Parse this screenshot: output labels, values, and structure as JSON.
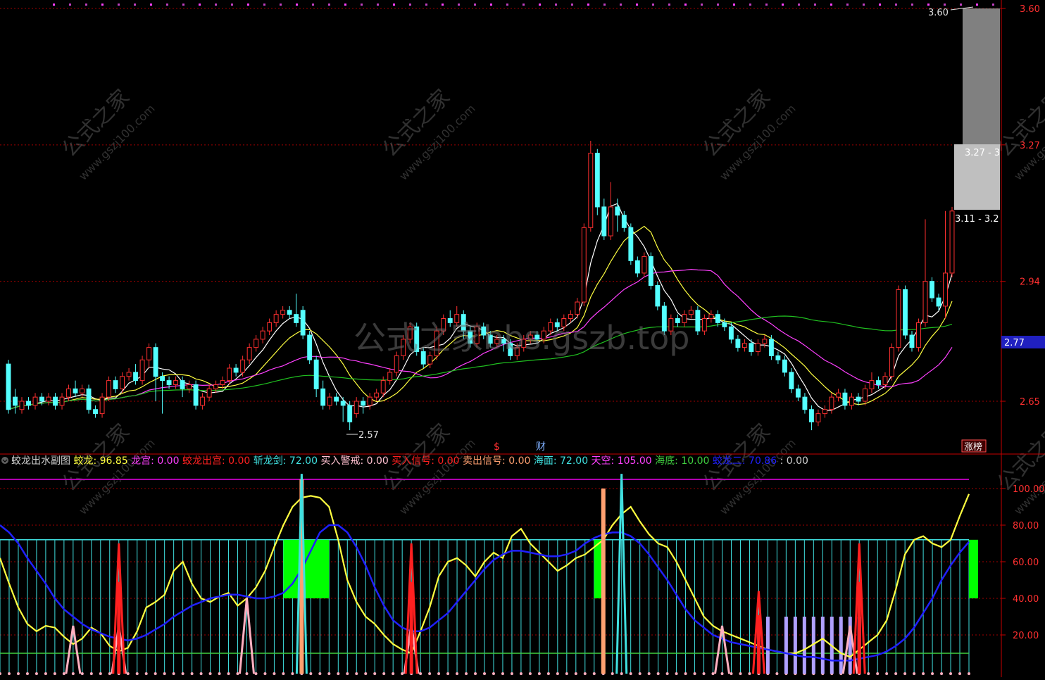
{
  "colors": {
    "background": "#000000",
    "up_candle": "#ff3030",
    "down_candle": "#54ffff",
    "axis_red": "#c80000",
    "ma5": "#ffffff",
    "ma10": "#ffff40",
    "ma20": "#ff40ff",
    "ma60": "#20c020",
    "jiaolong": "#ffff40",
    "long_curve": "#2020ff",
    "haimian": "#40e0e0",
    "tiankong": "#b000b0",
    "haidi": "#40d040",
    "sell_signal": "#ffa070",
    "buy_signal": "#ff2020",
    "alert": "#ffb0c0",
    "lavender": "#b0a0ff",
    "green_block": "#00ff00",
    "price_tag_bg": "#2020c0"
  },
  "main_chart": {
    "y_axis_labels": [
      "3.60",
      "3.27",
      "2.94",
      "2.65"
    ],
    "current_price_tag": "2.77",
    "high_marker": "3.60",
    "low_marker": "2.57",
    "range_box_upper": "3.27 - 3",
    "range_box_lower": "3.11 - 3.2",
    "event_s": "$",
    "event_cai": "财",
    "zhangbang": "涨榜"
  },
  "indicator_panel": {
    "title": "蛟龙出水副图",
    "legend": [
      {
        "label": "蛟龙:",
        "value": "96.85",
        "color": "#ffff40"
      },
      {
        "label": "龙宫:",
        "value": "0.00",
        "color": "#ff40ff"
      },
      {
        "label": "蛟龙出宫:",
        "value": "0.00",
        "color": "#ff2020"
      },
      {
        "label": "斩龙剑:",
        "value": "72.00",
        "color": "#40e0e0"
      },
      {
        "label": "买入警戒:",
        "value": "0.00",
        "color": "#ffc0d0"
      },
      {
        "label": "买入信号:",
        "value": "0.00",
        "color": "#ff2020"
      },
      {
        "label": "卖出信号:",
        "value": "0.00",
        "color": "#ffa070"
      },
      {
        "label": "海面:",
        "value": "72.00",
        "color": "#40e0e0"
      },
      {
        "label": "天空:",
        "value": "105.00",
        "color": "#ff40ff"
      },
      {
        "label": "海底:",
        "value": "10.00",
        "color": "#40d040"
      },
      {
        "label": "蛟龙二:",
        "value": "70.86",
        "color": "#2020ff"
      },
      {
        "label": ":",
        "value": "0.00",
        "color": "#d0d0d0"
      }
    ],
    "y_axis_labels": [
      "100.00",
      "80.00",
      "60.00",
      "40.00",
      "20.00"
    ]
  },
  "watermarks": {
    "main": "公式之家bbs.gszb.top",
    "tile_cn": "公式之家",
    "tile_url": "www.gszj100.com"
  },
  "chart_data": [
    {
      "type": "candlestick",
      "title": "",
      "ylim": [
        2.55,
        3.62
      ],
      "y_ticks": [
        3.6,
        3.27,
        2.94,
        2.65
      ],
      "candles": [
        [
          2.74,
          2.63,
          2.75,
          2.62
        ],
        [
          2.66,
          2.64,
          2.68,
          2.62
        ],
        [
          2.63,
          2.65,
          2.66,
          2.62
        ],
        [
          2.65,
          2.64,
          2.66,
          2.63
        ],
        [
          2.64,
          2.66,
          2.67,
          2.63
        ],
        [
          2.66,
          2.65,
          2.67,
          2.64
        ],
        [
          2.65,
          2.66,
          2.67,
          2.64
        ],
        [
          2.66,
          2.64,
          2.67,
          2.63
        ],
        [
          2.64,
          2.66,
          2.67,
          2.63
        ],
        [
          2.66,
          2.68,
          2.69,
          2.65
        ],
        [
          2.68,
          2.67,
          2.7,
          2.66
        ],
        [
          2.67,
          2.68,
          2.69,
          2.66
        ],
        [
          2.68,
          2.63,
          2.69,
          2.62
        ],
        [
          2.63,
          2.62,
          2.64,
          2.61
        ],
        [
          2.62,
          2.66,
          2.67,
          2.61
        ],
        [
          2.66,
          2.7,
          2.71,
          2.65
        ],
        [
          2.7,
          2.68,
          2.71,
          2.67
        ],
        [
          2.68,
          2.71,
          2.72,
          2.67
        ],
        [
          2.71,
          2.72,
          2.73,
          2.7
        ],
        [
          2.72,
          2.7,
          2.74,
          2.69
        ],
        [
          2.7,
          2.75,
          2.76,
          2.69
        ],
        [
          2.75,
          2.78,
          2.79,
          2.73
        ],
        [
          2.78,
          2.71,
          2.79,
          2.65
        ],
        [
          2.71,
          2.7,
          2.72,
          2.62
        ],
        [
          2.7,
          2.69,
          2.71,
          2.68
        ],
        [
          2.69,
          2.7,
          2.71,
          2.68
        ],
        [
          2.7,
          2.68,
          2.71,
          2.66
        ],
        [
          2.68,
          2.69,
          2.7,
          2.67
        ],
        [
          2.69,
          2.64,
          2.7,
          2.63
        ],
        [
          2.64,
          2.66,
          2.67,
          2.63
        ],
        [
          2.66,
          2.68,
          2.69,
          2.65
        ],
        [
          2.68,
          2.69,
          2.7,
          2.67
        ],
        [
          2.69,
          2.7,
          2.71,
          2.68
        ],
        [
          2.7,
          2.73,
          2.74,
          2.69
        ],
        [
          2.73,
          2.72,
          2.74,
          2.71
        ],
        [
          2.72,
          2.75,
          2.76,
          2.71
        ],
        [
          2.75,
          2.78,
          2.79,
          2.74
        ],
        [
          2.78,
          2.8,
          2.81,
          2.77
        ],
        [
          2.8,
          2.82,
          2.83,
          2.79
        ],
        [
          2.82,
          2.84,
          2.85,
          2.81
        ],
        [
          2.84,
          2.86,
          2.87,
          2.83
        ],
        [
          2.86,
          2.87,
          2.88,
          2.85
        ],
        [
          2.87,
          2.86,
          2.88,
          2.85
        ],
        [
          2.86,
          2.84,
          2.91,
          2.83
        ],
        [
          2.87,
          2.81,
          2.88,
          2.8
        ],
        [
          2.81,
          2.75,
          2.82,
          2.74
        ],
        [
          2.75,
          2.68,
          2.76,
          2.66
        ],
        [
          2.68,
          2.64,
          2.7,
          2.63
        ],
        [
          2.64,
          2.66,
          2.67,
          2.63
        ],
        [
          2.66,
          2.65,
          2.67,
          2.64
        ],
        [
          2.65,
          2.64,
          2.66,
          2.6
        ],
        [
          2.64,
          2.6,
          2.65,
          2.58
        ],
        [
          2.62,
          2.65,
          2.66,
          2.61
        ],
        [
          2.65,
          2.64,
          2.66,
          2.62
        ],
        [
          2.64,
          2.66,
          2.67,
          2.63
        ],
        [
          2.66,
          2.67,
          2.68,
          2.65
        ],
        [
          2.67,
          2.7,
          2.71,
          2.66
        ],
        [
          2.7,
          2.72,
          2.73,
          2.69
        ],
        [
          2.72,
          2.76,
          2.77,
          2.71
        ],
        [
          2.76,
          2.8,
          2.81,
          2.75
        ],
        [
          2.8,
          2.83,
          2.84,
          2.79
        ],
        [
          2.83,
          2.77,
          2.84,
          2.76
        ],
        [
          2.77,
          2.74,
          2.78,
          2.73
        ],
        [
          2.74,
          2.76,
          2.77,
          2.73
        ],
        [
          2.76,
          2.82,
          2.83,
          2.75
        ],
        [
          2.82,
          2.85,
          2.86,
          2.81
        ],
        [
          2.85,
          2.84,
          2.87,
          2.83
        ],
        [
          2.84,
          2.86,
          2.88,
          2.83
        ],
        [
          2.86,
          2.82,
          2.87,
          2.8
        ],
        [
          2.82,
          2.79,
          2.83,
          2.78
        ],
        [
          2.79,
          2.83,
          2.84,
          2.78
        ],
        [
          2.83,
          2.81,
          2.84,
          2.8
        ],
        [
          2.81,
          2.79,
          2.82,
          2.78
        ],
        [
          2.79,
          2.8,
          2.81,
          2.78
        ],
        [
          2.8,
          2.79,
          2.81,
          2.77
        ],
        [
          2.79,
          2.76,
          2.8,
          2.75
        ],
        [
          2.76,
          2.78,
          2.79,
          2.75
        ],
        [
          2.78,
          2.8,
          2.81,
          2.77
        ],
        [
          2.8,
          2.81,
          2.82,
          2.79
        ],
        [
          2.81,
          2.8,
          2.82,
          2.79
        ],
        [
          2.8,
          2.82,
          2.83,
          2.79
        ],
        [
          2.82,
          2.84,
          2.85,
          2.81
        ],
        [
          2.84,
          2.83,
          2.85,
          2.82
        ],
        [
          2.83,
          2.85,
          2.86,
          2.82
        ],
        [
          2.85,
          2.86,
          2.87,
          2.84
        ],
        [
          2.86,
          2.89,
          2.9,
          2.85
        ],
        [
          2.89,
          3.07,
          3.08,
          2.88
        ],
        [
          3.07,
          3.25,
          3.28,
          3.06
        ],
        [
          3.25,
          3.12,
          3.26,
          3.1
        ],
        [
          3.12,
          3.05,
          3.14,
          3.04
        ],
        [
          3.05,
          3.12,
          3.18,
          3.04
        ],
        [
          3.12,
          3.1,
          3.14,
          3.06
        ],
        [
          3.1,
          3.07,
          3.11,
          3.06
        ],
        [
          3.07,
          2.99,
          3.08,
          2.98
        ],
        [
          2.99,
          2.96,
          3.0,
          2.95
        ],
        [
          2.96,
          3.0,
          3.01,
          2.95
        ],
        [
          3.0,
          2.93,
          3.01,
          2.92
        ],
        [
          2.93,
          2.88,
          2.94,
          2.87
        ],
        [
          2.88,
          2.82,
          2.89,
          2.81
        ],
        [
          2.82,
          2.85,
          2.86,
          2.81
        ],
        [
          2.85,
          2.84,
          2.86,
          2.83
        ],
        [
          2.84,
          2.86,
          2.87,
          2.83
        ],
        [
          2.86,
          2.87,
          2.88,
          2.85
        ],
        [
          2.87,
          2.82,
          2.88,
          2.81
        ],
        [
          2.82,
          2.85,
          2.86,
          2.81
        ],
        [
          2.85,
          2.86,
          2.87,
          2.84
        ],
        [
          2.86,
          2.84,
          2.87,
          2.83
        ],
        [
          2.84,
          2.83,
          2.85,
          2.82
        ],
        [
          2.83,
          2.8,
          2.84,
          2.79
        ],
        [
          2.8,
          2.78,
          2.81,
          2.77
        ],
        [
          2.78,
          2.79,
          2.8,
          2.77
        ],
        [
          2.79,
          2.77,
          2.8,
          2.76
        ],
        [
          2.77,
          2.79,
          2.8,
          2.76
        ],
        [
          2.79,
          2.8,
          2.81,
          2.78
        ],
        [
          2.8,
          2.76,
          2.81,
          2.75
        ],
        [
          2.76,
          2.75,
          2.77,
          2.74
        ],
        [
          2.75,
          2.72,
          2.76,
          2.71
        ],
        [
          2.72,
          2.68,
          2.73,
          2.67
        ],
        [
          2.68,
          2.66,
          2.69,
          2.65
        ],
        [
          2.66,
          2.63,
          2.67,
          2.62
        ],
        [
          2.63,
          2.6,
          2.64,
          2.58
        ],
        [
          2.6,
          2.62,
          2.63,
          2.59
        ],
        [
          2.62,
          2.63,
          2.64,
          2.61
        ],
        [
          2.63,
          2.66,
          2.67,
          2.62
        ],
        [
          2.66,
          2.67,
          2.68,
          2.65
        ],
        [
          2.67,
          2.64,
          2.68,
          2.63
        ],
        [
          2.64,
          2.66,
          2.67,
          2.63
        ],
        [
          2.66,
          2.65,
          2.67,
          2.64
        ],
        [
          2.65,
          2.68,
          2.69,
          2.64
        ],
        [
          2.68,
          2.7,
          2.72,
          2.67
        ],
        [
          2.7,
          2.69,
          2.71,
          2.68
        ],
        [
          2.69,
          2.71,
          2.72,
          2.68
        ],
        [
          2.71,
          2.78,
          2.79,
          2.7
        ],
        [
          2.78,
          2.92,
          2.93,
          2.77
        ],
        [
          2.92,
          2.81,
          2.93,
          2.8
        ],
        [
          2.81,
          2.78,
          2.82,
          2.77
        ],
        [
          2.78,
          2.84,
          2.85,
          2.77
        ],
        [
          2.84,
          2.94,
          3.09,
          2.83
        ],
        [
          2.94,
          2.9,
          2.95,
          2.89
        ],
        [
          2.9,
          2.88,
          2.91,
          2.87
        ],
        [
          2.88,
          2.96,
          3.11,
          2.85
        ],
        [
          2.96,
          3.11,
          3.12,
          2.95
        ]
      ]
    },
    {
      "type": "line",
      "title": "蛟龙出水副图",
      "ylim": [
        0,
        110
      ],
      "y_ticks": [
        100,
        80,
        60,
        40,
        20
      ],
      "series": [
        {
          "name": "蛟龙",
          "values": [
            62,
            48,
            35,
            26,
            22,
            25,
            24,
            19,
            15,
            18,
            24,
            21,
            14,
            11,
            13,
            22,
            35,
            38,
            42,
            55,
            60,
            48,
            40,
            38,
            41,
            43,
            36,
            40,
            46,
            55,
            68,
            80,
            90,
            95,
            96,
            95,
            90,
            72,
            50,
            38,
            30,
            26,
            20,
            15,
            12,
            10,
            22,
            35,
            52,
            60,
            62,
            58,
            52,
            60,
            65,
            62,
            74,
            78,
            70,
            65,
            60,
            55,
            58,
            62,
            64,
            68,
            72,
            80,
            86,
            90,
            82,
            75,
            70,
            68,
            60,
            50,
            40,
            30,
            25,
            22,
            20,
            18,
            16,
            14,
            12,
            11,
            10,
            10,
            12,
            15,
            18,
            14,
            10,
            8,
            12,
            16,
            20,
            28,
            45,
            64,
            72,
            74,
            70,
            68,
            72,
            85,
            97
          ]
        },
        {
          "name": "蛟龙二",
          "values": [
            80,
            76,
            70,
            62,
            55,
            48,
            40,
            34,
            30,
            26,
            23,
            21,
            19,
            18,
            17,
            18,
            20,
            23,
            26,
            30,
            33,
            36,
            38,
            40,
            41,
            42,
            42,
            41,
            40,
            40,
            41,
            43,
            48,
            56,
            66,
            76,
            80,
            80,
            76,
            68,
            58,
            46,
            36,
            28,
            24,
            22,
            22,
            24,
            28,
            32,
            38,
            44,
            50,
            56,
            61,
            64,
            66,
            66,
            65,
            64,
            63,
            63,
            64,
            66,
            70,
            73,
            75,
            76,
            76,
            74,
            70,
            64,
            57,
            50,
            42,
            34,
            28,
            24,
            20,
            18,
            16,
            15,
            14,
            13,
            12,
            11,
            10,
            9,
            8,
            8,
            7,
            6,
            6,
            6,
            7,
            8,
            9,
            11,
            14,
            18,
            24,
            32,
            40,
            50,
            58,
            65,
            70.86
          ]
        },
        {
          "name": "海面",
          "values": [
            72
          ]
        },
        {
          "name": "天空",
          "values": [
            105
          ]
        },
        {
          "name": "海底",
          "values": [
            10
          ]
        }
      ],
      "signals": {
        "卖出信号": [
          [
            33,
            105
          ],
          [
            66,
            100
          ]
        ],
        "买入信号": [
          [
            13,
            70
          ],
          [
            45,
            70
          ],
          [
            94,
            70
          ],
          [
            83,
            44
          ]
        ],
        "买入警戒": [
          [
            8,
            25
          ],
          [
            13,
            25
          ],
          [
            27,
            40
          ],
          [
            45,
            26
          ],
          [
            79,
            25
          ],
          [
            93,
            25
          ]
        ],
        "green_blocks": [
          [
            31,
            36,
            72,
            40
          ],
          [
            65,
            66,
            72,
            40
          ],
          [
            106,
            107,
            72,
            40
          ]
        ],
        "lavender_bars": [
          83,
          84,
          86,
          87,
          88,
          89,
          90,
          91,
          92,
          93,
          94
        ]
      }
    }
  ]
}
